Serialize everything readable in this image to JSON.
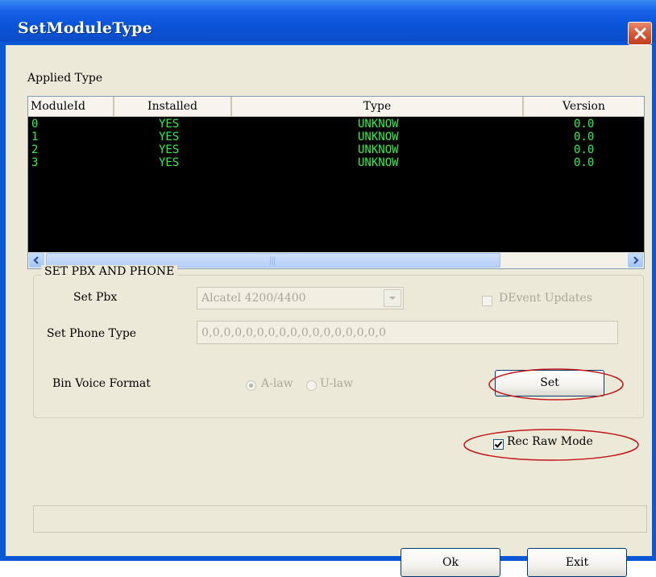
{
  "window": {
    "title": "SetModuleType"
  },
  "applied_type": {
    "label": "Applied Type",
    "columns": [
      "ModuleId",
      "Installed",
      "Type",
      "Version"
    ],
    "rows": [
      [
        "0",
        "YES",
        "UNKNOW",
        "0.0"
      ],
      [
        "1",
        "YES",
        "UNKNOW",
        "0.0"
      ],
      [
        "2",
        "YES",
        "UNKNOW",
        "0.0"
      ],
      [
        "3",
        "YES",
        "UNKNOW",
        "0.0"
      ]
    ],
    "text_color": "#2ff048",
    "background_color": "#000000"
  },
  "pbx_group": {
    "legend": "SET PBX AND PHONE",
    "set_pbx_label": "Set Pbx",
    "set_pbx_value": "Alcatel 4200/4400",
    "devent_label": "DEvent Updates",
    "devent_checked": false,
    "phone_type_label": "Set Phone Type",
    "phone_type_value": "0,0,0,0,0,0,0,0,0,0,0,0,0,0,0,0,0",
    "bin_voice_label": "Bin Voice Format",
    "alaw_label": "A-law",
    "ulaw_label": "U-law",
    "selected_format": "A-law",
    "set_button": "Set"
  },
  "rec_raw_mode": {
    "label": "Rec Raw Mode",
    "checked": true
  },
  "buttons": {
    "ok": "Ok",
    "exit": "Exit"
  },
  "icons": {
    "close": "close-icon",
    "scroll_left": "chevron-left-icon",
    "scroll_right": "chevron-right-icon",
    "combo": "chevron-down-icon",
    "check": "check-icon"
  },
  "colors": {
    "title_bar": "#0a54d8",
    "dialog_bg": "#ece9d8",
    "annotation": "#c01818"
  }
}
